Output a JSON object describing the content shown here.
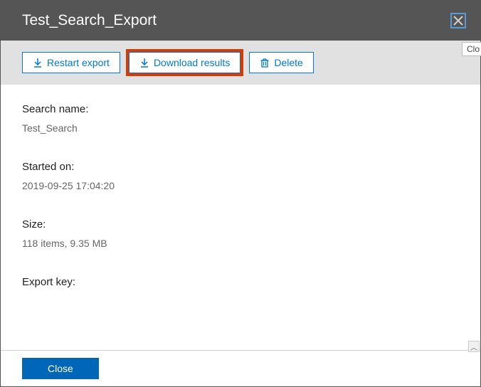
{
  "header": {
    "title": "Test_Search_Export",
    "tooltip_partial": "Clo"
  },
  "toolbar": {
    "restart_label": "Restart export",
    "download_label": "Download results",
    "delete_label": "Delete"
  },
  "details": {
    "search_name": {
      "label": "Search name:",
      "value": "Test_Search"
    },
    "started_on": {
      "label": "Started on:",
      "value": "2019-09-25 17:04:20"
    },
    "size": {
      "label": "Size:",
      "value": "118 items, 9.35 MB"
    },
    "export_key": {
      "label": "Export key:"
    }
  },
  "footer": {
    "close_label": "Close"
  }
}
